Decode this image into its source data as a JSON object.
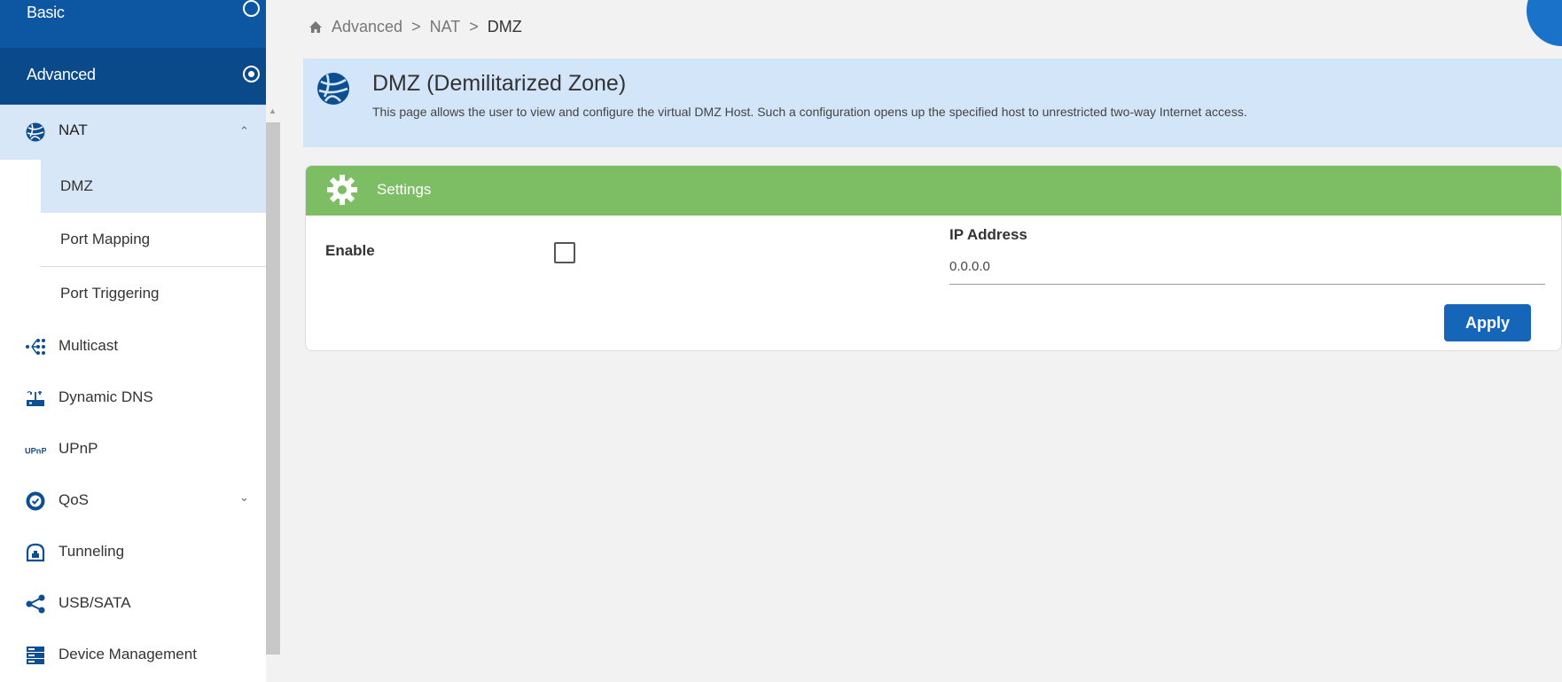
{
  "sidebar": {
    "modes": {
      "basic": "Basic",
      "advanced": "Advanced"
    },
    "nat": {
      "label": "NAT",
      "children": [
        "DMZ",
        "Port Mapping",
        "Port Triggering"
      ]
    },
    "items": [
      {
        "label": "Multicast",
        "icon": "multicast-icon"
      },
      {
        "label": "Dynamic DNS",
        "icon": "router-icon"
      },
      {
        "label": "UPnP",
        "icon": "upnp-icon"
      },
      {
        "label": "QoS",
        "icon": "qos-icon"
      },
      {
        "label": "Tunneling",
        "icon": "tunnel-icon"
      },
      {
        "label": "USB/SATA",
        "icon": "share-icon"
      },
      {
        "label": "Device Management",
        "icon": "server-icon"
      }
    ],
    "active_child": "DMZ"
  },
  "breadcrumb": {
    "items": [
      "Advanced",
      "NAT",
      "DMZ"
    ],
    "separator": ">"
  },
  "page": {
    "title": "DMZ (Demilitarized Zone)",
    "description": "This page allows the user to view and configure the virtual DMZ Host. Such a configuration opens up the specified host to unrestricted two-way Internet access."
  },
  "settings": {
    "title": "Settings",
    "enable_label": "Enable",
    "enable_checked": false,
    "ip_label": "IP Address",
    "ip_value": "0.0.0.0",
    "apply_label": "Apply"
  },
  "colors": {
    "mode_tab": "#0a4a8a",
    "active_bg": "#d7e7f8",
    "header_bg": "#d3e5f8",
    "settings_bar": "#7dbe65",
    "apply_button": "#1565b8",
    "accent_blue": "#1a73c9"
  }
}
